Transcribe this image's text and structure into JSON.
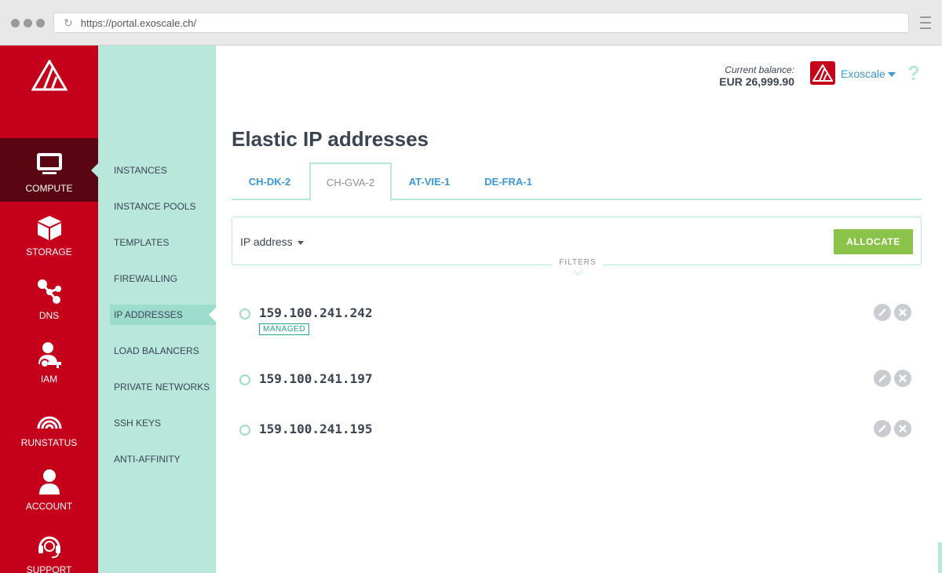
{
  "browser": {
    "url": "https://portal.exoscale.ch/"
  },
  "sidebar": {
    "items": [
      {
        "label": "COMPUTE",
        "icon": "monitor-icon",
        "active": true
      },
      {
        "label": "STORAGE",
        "icon": "cube-icon"
      },
      {
        "label": "DNS",
        "icon": "network-icon"
      },
      {
        "label": "IAM",
        "icon": "user-key-icon"
      },
      {
        "label": "RUNSTATUS",
        "icon": "signal-icon"
      },
      {
        "label": "ACCOUNT",
        "icon": "user-icon"
      },
      {
        "label": "SUPPORT",
        "icon": "headset-icon"
      }
    ]
  },
  "subnav": {
    "items": [
      {
        "label": "INSTANCES"
      },
      {
        "label": "INSTANCE POOLS"
      },
      {
        "label": "TEMPLATES"
      },
      {
        "label": "FIREWALLING"
      },
      {
        "label": "IP ADDRESSES",
        "active": true
      },
      {
        "label": "LOAD BALANCERS"
      },
      {
        "label": "PRIVATE NETWORKS"
      },
      {
        "label": "SSH KEYS"
      },
      {
        "label": "ANTI-AFFINITY"
      }
    ]
  },
  "header": {
    "balance_label": "Current balance:",
    "balance_value": "EUR 26,999.90",
    "org_name": "Exoscale",
    "help_label": "?"
  },
  "page": {
    "title": "Elastic IP addresses",
    "tabs": [
      {
        "label": "CH-DK-2"
      },
      {
        "label": "CH-GVA-2",
        "active": true
      },
      {
        "label": "AT-VIE-1"
      },
      {
        "label": "DE-FRA-1"
      }
    ],
    "filter": {
      "select_label": "IP address",
      "allocate_label": "ALLOCATE",
      "filters_label": "FILTERS"
    },
    "ips": [
      {
        "address": "159.100.241.242",
        "badge": "MANAGED"
      },
      {
        "address": "159.100.241.197"
      },
      {
        "address": "159.100.241.195"
      }
    ]
  },
  "colors": {
    "brand_red": "#c4001a",
    "active_dark": "#5a0612",
    "mint": "#b8e8dc",
    "link_blue": "#3a98d6",
    "allocate_green": "#8bc34a",
    "badge_green": "#26a689"
  }
}
